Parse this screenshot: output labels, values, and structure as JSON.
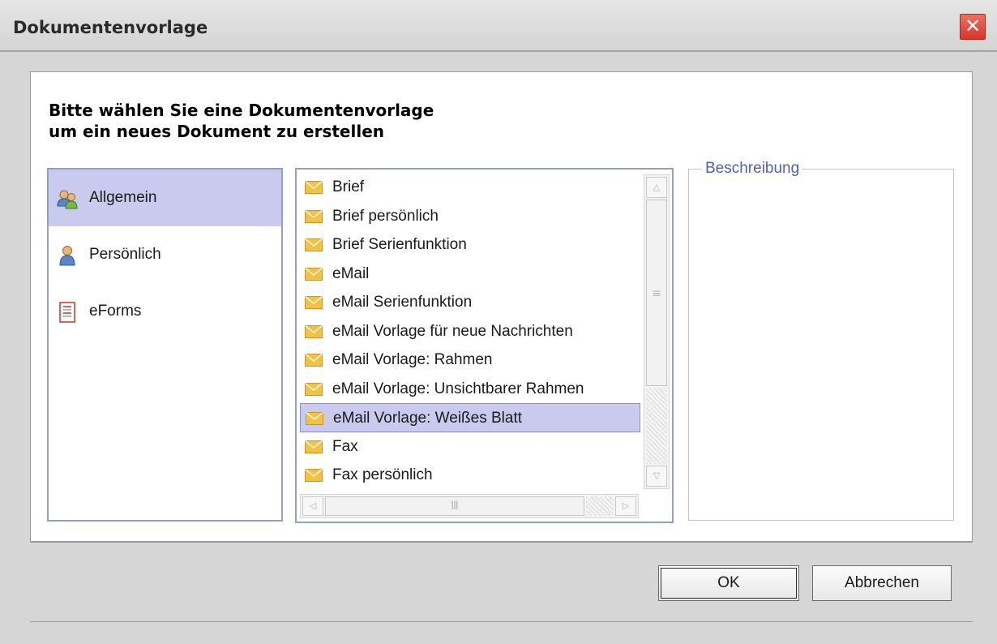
{
  "window": {
    "title": "Dokumentenvorlage",
    "close_symbol": "✕"
  },
  "heading": {
    "line1": "Bitte wählen Sie eine Dokumentenvorlage",
    "line2": "um ein neues Dokument zu erstellen"
  },
  "categories": [
    {
      "label": "Allgemein",
      "icon": "users-group-icon",
      "selected": true
    },
    {
      "label": "Persönlich",
      "icon": "user-icon",
      "selected": false
    },
    {
      "label": "eForms",
      "icon": "form-icon",
      "selected": false
    }
  ],
  "templates": [
    {
      "label": "Brief",
      "selected": false
    },
    {
      "label": "Brief persönlich",
      "selected": false
    },
    {
      "label": "Brief Serienfunktion",
      "selected": false
    },
    {
      "label": "eMail",
      "selected": false
    },
    {
      "label": "eMail Serienfunktion",
      "selected": false
    },
    {
      "label": "eMail Vorlage für neue Nachrichten",
      "selected": false
    },
    {
      "label": "eMail Vorlage: Rahmen",
      "selected": false
    },
    {
      "label": "eMail Vorlage: Unsichtbarer Rahmen",
      "selected": false
    },
    {
      "label": "eMail Vorlage: Weißes Blatt",
      "selected": true
    },
    {
      "label": "Fax",
      "selected": false
    },
    {
      "label": "Fax persönlich",
      "selected": false
    }
  ],
  "description": {
    "legend": "Beschreibung"
  },
  "buttons": {
    "ok": "OK",
    "cancel": "Abbrechen"
  },
  "colors": {
    "selection": "#c8cbee",
    "panel_border": "#8fa3c0",
    "legend_text": "#4f5fb8",
    "close_button": "#d8352a",
    "envelope": "#f3c242"
  }
}
